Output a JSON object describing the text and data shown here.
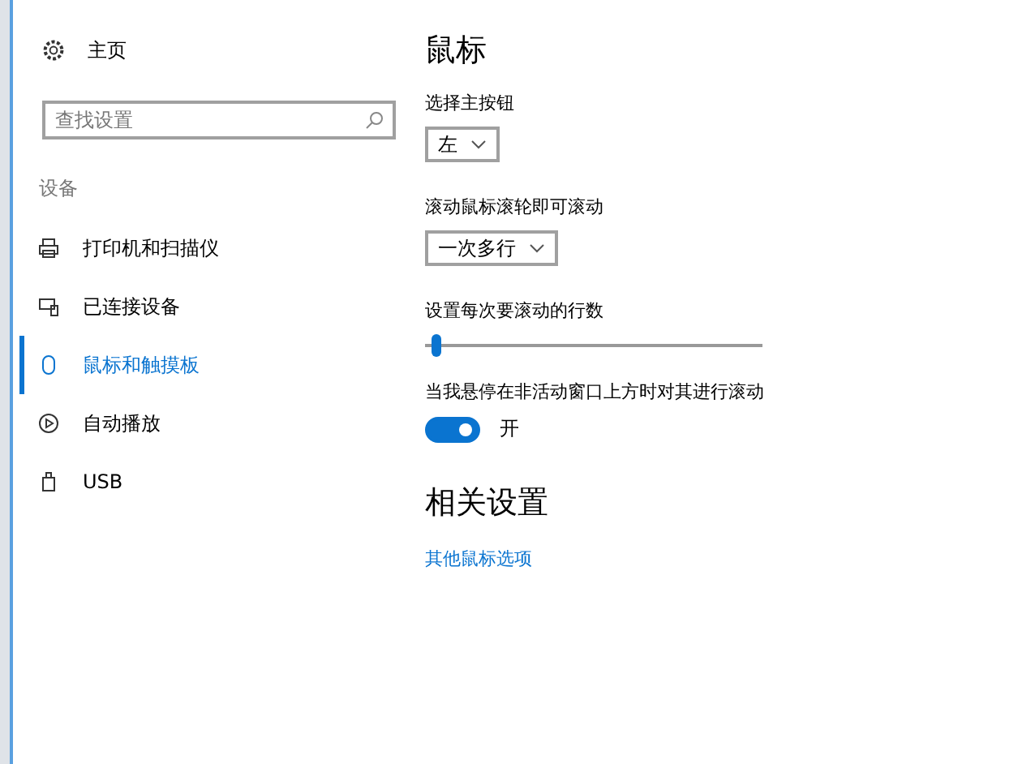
{
  "sidebar": {
    "home": "主页",
    "search": {
      "placeholder": "查找设置"
    },
    "section": "设备",
    "items": [
      {
        "label": "打印机和扫描仪",
        "kind": "printer",
        "selected": false
      },
      {
        "label": "已连接设备",
        "kind": "devices",
        "selected": false
      },
      {
        "label": "鼠标和触摸板",
        "kind": "mouse",
        "selected": true
      },
      {
        "label": "自动播放",
        "kind": "autoplay",
        "selected": false
      },
      {
        "label": "USB",
        "kind": "usb",
        "selected": false
      }
    ]
  },
  "content": {
    "title": "鼠标",
    "primary_button": {
      "label": "选择主按钮",
      "value": "左"
    },
    "scroll_mode": {
      "label": "滚动鼠标滚轮即可滚动",
      "value": "一次多行"
    },
    "lines_slider": {
      "label": "设置每次要滚动的行数",
      "level": 0.02
    },
    "inactive_scroll": {
      "label": "当我悬停在非活动窗口上方时对其进行滚动",
      "on": true,
      "state_text": "开"
    },
    "related_title": "相关设置",
    "related_link": "其他鼠标选项"
  }
}
